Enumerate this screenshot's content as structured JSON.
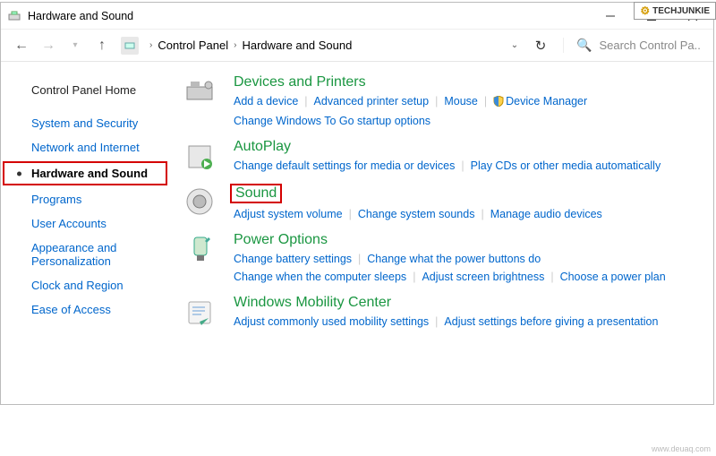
{
  "window": {
    "title": "Hardware and Sound"
  },
  "breadcrumb": {
    "root": "Control Panel",
    "current": "Hardware and Sound"
  },
  "search": {
    "placeholder": "Search Control Pa.."
  },
  "sidebar": {
    "home": "Control Panel Home",
    "items": [
      "System and Security",
      "Network and Internet",
      "Hardware and Sound",
      "Programs",
      "User Accounts",
      "Appearance and Personalization",
      "Clock and Region",
      "Ease of Access"
    ],
    "active_index": 2
  },
  "categories": [
    {
      "title": "Devices and Printers",
      "links": [
        "Add a device",
        "Advanced printer setup",
        "Mouse",
        "Device Manager",
        "Change Windows To Go startup options"
      ],
      "shield_at": 3,
      "break_before": 4
    },
    {
      "title": "AutoPlay",
      "links": [
        "Change default settings for media or devices",
        "Play CDs or other media automatically"
      ]
    },
    {
      "title": "Sound",
      "highlighted": true,
      "links": [
        "Adjust system volume",
        "Change system sounds",
        "Manage audio devices"
      ]
    },
    {
      "title": "Power Options",
      "links": [
        "Change battery settings",
        "Change what the power buttons do",
        "Change when the computer sleeps",
        "Adjust screen brightness",
        "Choose a power plan"
      ],
      "break_before": 2
    },
    {
      "title": "Windows Mobility Center",
      "links": [
        "Adjust commonly used mobility settings",
        "Adjust settings before giving a presentation"
      ]
    }
  ],
  "watermark": {
    "logo": "TECHJUNKIE",
    "footer": "www.deuaq.com"
  }
}
